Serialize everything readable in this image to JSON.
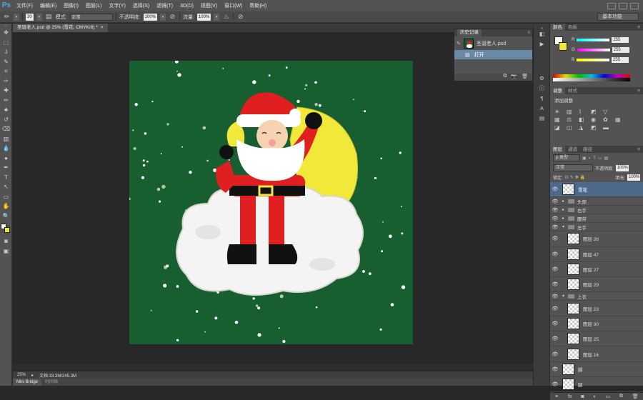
{
  "app": {
    "logo": "Ps"
  },
  "menu": [
    "文件(F)",
    "编辑(E)",
    "图像(I)",
    "图层(L)",
    "文字(Y)",
    "选择(S)",
    "滤镜(T)",
    "3D(D)",
    "视图(V)",
    "窗口(W)",
    "帮助(H)"
  ],
  "options": {
    "brush_size": "30",
    "mode_label": "模式:",
    "mode_value": "正常",
    "opacity_label": "不透明度:",
    "opacity_value": "100%",
    "flow_label": "流量:",
    "flow_value": "100%",
    "workspace": "基本功能"
  },
  "document": {
    "tab_title": "圣诞老人.psd @ 25% (雪花, CMYK/8) *",
    "close": "×",
    "zoom": "25%",
    "doc_size": "文档:33.3M/245.3M"
  },
  "bottom_tabs": [
    "Mini Bridge",
    "时间轴"
  ],
  "history": {
    "title": "历史记录",
    "snapshot": "圣诞老人.psd",
    "step": "打开"
  },
  "color_panel": {
    "tabs": [
      "颜色",
      "色板"
    ],
    "r_label": "R",
    "r_value": "255",
    "g_label": "G",
    "g_value": "255",
    "b_label": "B",
    "b_value": "255"
  },
  "adjust_panel": {
    "tabs": [
      "调整",
      "样式"
    ],
    "heading": "添加调整"
  },
  "layers_panel": {
    "tabs": [
      "图层",
      "通道",
      "路径"
    ],
    "kind_filter": "ρ 类型",
    "blend_mode": "正常",
    "opacity_label": "不透明度:",
    "opacity_value": "100%",
    "lock_label": "锁定:",
    "fill_label": "填充:",
    "fill_value": "100%",
    "layers": [
      {
        "name": "雪花",
        "type": "layer",
        "selected": true,
        "indent": 0
      },
      {
        "name": "头部",
        "type": "group",
        "indent": 0
      },
      {
        "name": "右手",
        "type": "group",
        "indent": 0
      },
      {
        "name": "腰带",
        "type": "group",
        "indent": 0
      },
      {
        "name": "左手",
        "type": "group",
        "open": true,
        "indent": 0
      },
      {
        "name": "图层 26",
        "type": "layer",
        "indent": 1
      },
      {
        "name": "图层 47",
        "type": "layer",
        "indent": 1
      },
      {
        "name": "图层 27",
        "type": "layer",
        "indent": 1
      },
      {
        "name": "图层 29",
        "type": "layer",
        "indent": 1
      },
      {
        "name": "上衣",
        "type": "group",
        "open": true,
        "indent": 0
      },
      {
        "name": "图层 23",
        "type": "layer",
        "indent": 1
      },
      {
        "name": "图层 30",
        "type": "layer",
        "indent": 1
      },
      {
        "name": "图层 25",
        "type": "layer",
        "indent": 1
      },
      {
        "name": "图层 16",
        "type": "layer",
        "indent": 1
      },
      {
        "name": "脚",
        "type": "layer",
        "indent": 0
      },
      {
        "name": "腿",
        "type": "layer",
        "indent": 0
      }
    ]
  },
  "colors": {
    "canvas_bg": "#175e31",
    "santa_red": "#e02020",
    "sack_yellow": "#f1e83a",
    "selection_blue": "#4d6a8c"
  },
  "icons": {
    "tools": [
      "move-icon",
      "marquee-icon",
      "lasso-icon",
      "quick-select-icon",
      "crop-icon",
      "eyedropper-icon",
      "healing-icon",
      "brush-icon",
      "stamp-icon",
      "history-brush-icon",
      "eraser-icon",
      "gradient-icon",
      "blur-icon",
      "dodge-icon",
      "pen-icon",
      "type-icon",
      "path-select-icon",
      "shape-icon",
      "hand-icon",
      "zoom-icon"
    ],
    "tool_glyphs": [
      "✥",
      "⬚",
      "ʖ",
      "✎",
      "⌗",
      "✑",
      "✚",
      "✏",
      "♣",
      "↺",
      "⌫",
      "▥",
      "💧",
      "●",
      "✒",
      "T",
      "↖",
      "▭",
      "✋",
      "🔍"
    ]
  }
}
